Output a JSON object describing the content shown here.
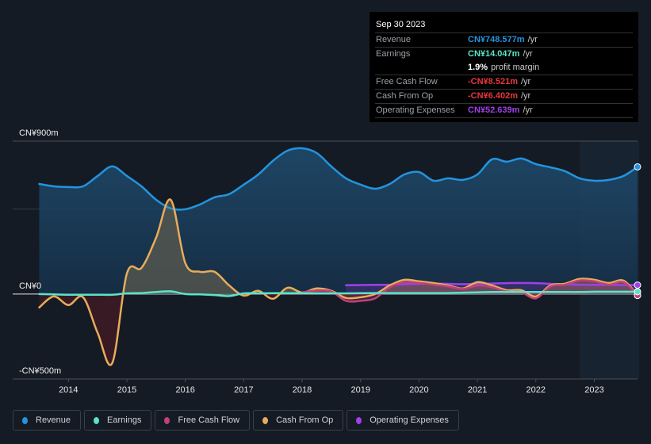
{
  "tooltip": {
    "date": "Sep 30 2023",
    "rows": [
      {
        "label": "Revenue",
        "value": "CN¥748.577m",
        "unit": "/yr",
        "color": "#2394df"
      },
      {
        "label": "Earnings",
        "value": "CN¥14.047m",
        "unit": "/yr",
        "color": "#5be3c9"
      },
      {
        "label": "",
        "value": "1.9%",
        "unit": "profit margin",
        "color": "#ffffff"
      },
      {
        "label": "Free Cash Flow",
        "value": "-CN¥8.521m",
        "unit": "/yr",
        "color": "#e8383d"
      },
      {
        "label": "Cash From Op",
        "value": "-CN¥6.402m",
        "unit": "/yr",
        "color": "#e8383d"
      },
      {
        "label": "Operating Expenses",
        "value": "CN¥52.639m",
        "unit": "/yr",
        "color": "#a040e8"
      }
    ]
  },
  "legend": [
    {
      "label": "Revenue",
      "color": "#2394df"
    },
    {
      "label": "Earnings",
      "color": "#5be3c9"
    },
    {
      "label": "Free Cash Flow",
      "color": "#c2407a"
    },
    {
      "label": "Cash From Op",
      "color": "#e8ac5a"
    },
    {
      "label": "Operating Expenses",
      "color": "#a040e8"
    }
  ],
  "chart_data": {
    "type": "area",
    "title": "",
    "xlabel": "",
    "ylabel": "",
    "currency_unit": "CN¥ millions",
    "ylim": [
      -500,
      900
    ],
    "y_ticks": [
      {
        "value": 900,
        "label": "CN¥900m"
      },
      {
        "value": 0,
        "label": "CN¥0"
      },
      {
        "value": -500,
        "label": "-CN¥500m"
      }
    ],
    "x_ticks": [
      "2014",
      "2015",
      "2016",
      "2017",
      "2018",
      "2019",
      "2020",
      "2021",
      "2022",
      "2023"
    ],
    "xlim": [
      2013.48,
      2023.74
    ],
    "highlight_start": 2022.75,
    "grid": true,
    "legend_position": "bottom",
    "x": [
      2013.5,
      2013.75,
      2014.0,
      2014.25,
      2014.5,
      2014.75,
      2015.0,
      2015.25,
      2015.5,
      2015.75,
      2016.0,
      2016.25,
      2016.5,
      2016.75,
      2017.0,
      2017.25,
      2017.5,
      2017.75,
      2018.0,
      2018.25,
      2018.5,
      2018.75,
      2019.0,
      2019.25,
      2019.5,
      2019.75,
      2020.0,
      2020.25,
      2020.5,
      2020.75,
      2021.0,
      2021.25,
      2021.5,
      2021.75,
      2022.0,
      2022.25,
      2022.5,
      2022.75,
      2023.0,
      2023.25,
      2023.5,
      2023.74
    ],
    "series": [
      {
        "name": "Revenue",
        "color": "#2394df",
        "values": [
          648,
          634,
          630,
          634,
          695,
          751,
          695,
          634,
          555,
          504,
          499,
          527,
          569,
          588,
          644,
          704,
          784,
          844,
          858,
          830,
          751,
          681,
          644,
          620,
          648,
          704,
          718,
          667,
          681,
          672,
          704,
          793,
          779,
          798,
          765,
          746,
          723,
          681,
          667,
          672,
          695,
          748.6
        ]
      },
      {
        "name": "Earnings",
        "color": "#5be3c9",
        "values": [
          0,
          -2,
          -4,
          -4,
          -4,
          -4,
          4,
          6,
          12,
          16,
          0,
          -2,
          -6,
          -12,
          4,
          4,
          5,
          5,
          5,
          4,
          4,
          4,
          5,
          6,
          6,
          6,
          6,
          6,
          6,
          8,
          10,
          12,
          12,
          12,
          12,
          12,
          12,
          12,
          14,
          14,
          14,
          14.0
        ]
      },
      {
        "name": "Free Cash Flow",
        "color": "#c2407a",
        "values": [
          null,
          null,
          null,
          null,
          null,
          null,
          null,
          null,
          null,
          null,
          null,
          null,
          null,
          null,
          null,
          null,
          null,
          null,
          10,
          20,
          15,
          -40,
          -40,
          -25,
          40,
          70,
          65,
          55,
          45,
          30,
          50,
          40,
          15,
          10,
          -25,
          45,
          55,
          80,
          75,
          55,
          70,
          -8.5
        ]
      },
      {
        "name": "Cash From Op",
        "color": "#e8ac5a",
        "values": [
          -79,
          -14,
          -65,
          -19,
          -229,
          -406,
          121,
          154,
          331,
          555,
          182,
          131,
          131,
          51,
          -9,
          19,
          -28,
          37,
          9,
          33,
          19,
          -23,
          -19,
          0,
          51,
          84,
          75,
          65,
          51,
          33,
          70,
          51,
          23,
          23,
          -14,
          51,
          61,
          89,
          84,
          65,
          79,
          -6.4
        ]
      },
      {
        "name": "Operating Expenses",
        "color": "#a040e8",
        "values": [
          null,
          null,
          null,
          null,
          null,
          null,
          null,
          null,
          null,
          null,
          null,
          null,
          null,
          null,
          null,
          null,
          null,
          null,
          null,
          null,
          null,
          52,
          53,
          54,
          55,
          58,
          60,
          61,
          60,
          58,
          60,
          62,
          64,
          65,
          64,
          60,
          57,
          55,
          54,
          53,
          53,
          52.6
        ]
      }
    ]
  }
}
